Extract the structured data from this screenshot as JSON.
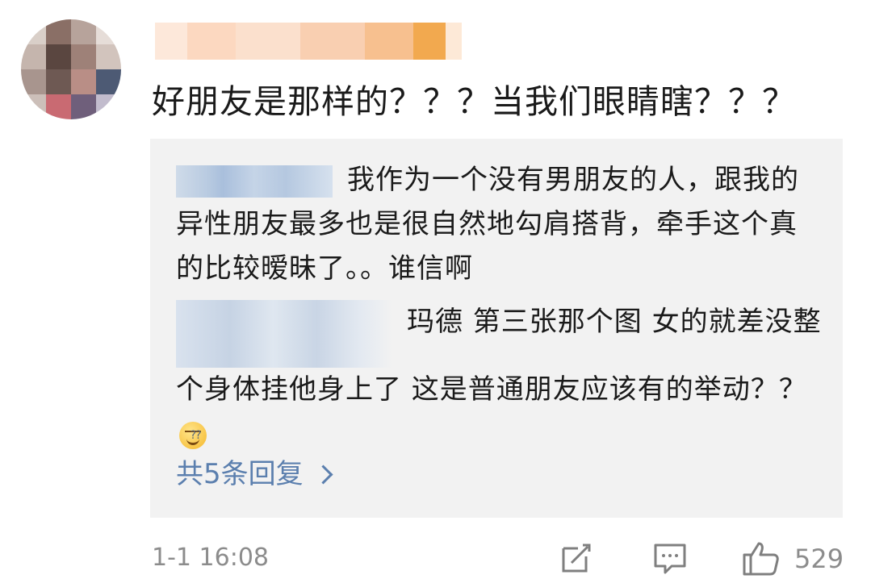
{
  "comment": {
    "text": "好朋友是那样的？？？当我们眼睛瞎？？？",
    "timestamp": "1-1 16:08",
    "like_count": "529"
  },
  "replies": [
    {
      "text": "我作为一个没有男朋友的人，跟我的异性朋友最多也是很自然地勾肩搭背，牵手这个真的比较暧昧了。。谁信啊"
    },
    {
      "text": "玛德 第三张那个图 女的就差没整个身体挂他身上了 这是普通朋友应该有的举动？？",
      "emoji": "sweat-smile-emoji"
    }
  ],
  "more_replies_label": "共5条回复",
  "icons": {
    "edit": "edit-icon",
    "comment": "comment-icon",
    "like": "thumbs-up-icon",
    "chevron": "chevron-right-icon"
  },
  "colors": {
    "reply_bg": "#f2f2f2",
    "link": "#5b7fae",
    "meta": "#8c8c8c"
  }
}
